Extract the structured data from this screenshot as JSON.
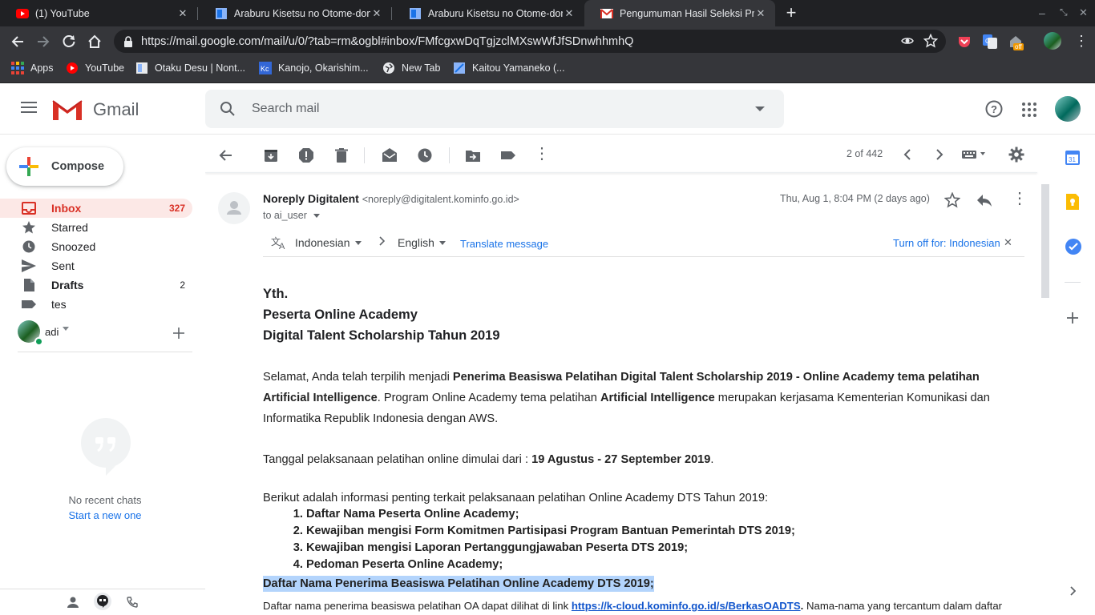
{
  "browser": {
    "tabs": [
      {
        "title": "(1) YouTube",
        "icon": "youtube-icon",
        "active": false
      },
      {
        "title": "Araburu Kisetsu no Otome-dom",
        "icon": "page-icon",
        "active": false
      },
      {
        "title": "Araburu Kisetsu no Otome-dom",
        "icon": "page-icon",
        "active": false
      },
      {
        "title": "Pengumuman Hasil Seleksi Pro",
        "icon": "gmail-icon",
        "active": true
      }
    ],
    "new_tab": "+",
    "url": "https://mail.google.com/mail/u/0/?tab=rm&ogbl#inbox/FMfcgxwDqTgjzclMXswWfJfSDnwhhmhQ",
    "ext_badge": "off",
    "bookmarks": [
      {
        "label": "Apps",
        "icon": "apps-grid-icon"
      },
      {
        "label": "YouTube",
        "icon": "youtube-icon"
      },
      {
        "label": "Otaku Desu | Nont...",
        "icon": "page-icon"
      },
      {
        "label": "Kanojo, Okarishim...",
        "icon": "kc-icon"
      },
      {
        "label": "New Tab",
        "icon": "globe-icon"
      },
      {
        "label": "Kaitou Yamaneko (...",
        "icon": "page-icon"
      }
    ]
  },
  "gmail": {
    "logo_text": "Gmail",
    "search_placeholder": "Search mail",
    "compose_label": "Compose",
    "nav": [
      {
        "label": "Inbox",
        "count": "327",
        "icon": "inbox-icon",
        "active": true
      },
      {
        "label": "Starred",
        "count": "",
        "icon": "star-icon",
        "active": false
      },
      {
        "label": "Snoozed",
        "count": "",
        "icon": "clock-icon",
        "active": false
      },
      {
        "label": "Sent",
        "count": "",
        "icon": "send-icon",
        "active": false
      },
      {
        "label": "Drafts",
        "count": "2",
        "icon": "draft-icon",
        "active": false
      },
      {
        "label": "tes",
        "count": "",
        "icon": "label-icon",
        "active": false
      }
    ],
    "hangouts": {
      "user": "adi",
      "no_chats": "No recent chats",
      "start_new": "Start a new one"
    },
    "toolbar": {
      "pager": "2 of 442"
    },
    "email": {
      "sender_name": "Noreply Digitalent",
      "sender_email": "<noreply@digitalent.kominfo.go.id>",
      "to": "to ai_user",
      "date": "Thu, Aug 1, 8:04 PM (2 days ago)",
      "translate": {
        "from_lang": "Indonesian",
        "to_lang": "English",
        "translate_link": "Translate message",
        "turn_off": "Turn off for: Indonesian"
      },
      "greeting": [
        "Yth.",
        "Peserta Online Academy",
        "Digital Talent Scholarship Tahun 2019"
      ],
      "p1_a": "Selamat, Anda telah terpilih menjadi ",
      "p1_b": "Penerima Beasiswa Pelatihan Digital Talent Scholarship 2019 - Online Academy tema pelatihan",
      "p1_c": "Artificial Intelligence",
      "p1_d": ". Program Online Academy tema pelatihan ",
      "p1_e": "Artificial Intelligence",
      "p1_f": " merupakan kerjasama Kementerian Komunikasi dan",
      "p1_g": "Informatika Republik Indonesia dengan AWS.",
      "p2_a": "Tanggal pelaksanaan pelatihan online dimulai dari : ",
      "p2_b": "19 Agustus - 27 September 2019",
      "p2_c": ".",
      "p3": "Berikut adalah informasi penting terkait pelaksanaan pelatihan Online Academy DTS Tahun 2019:",
      "list": [
        "Daftar Nama Peserta Online Academy;",
        "Kewajiban mengisi Form Komitmen Partisipasi Program Bantuan Pemerintah DTS 2019;",
        "Kewajiban mengisi Laporan Pertanggungjawaban Peserta DTS 2019;",
        "Pedoman Peserta Online Academy;"
      ],
      "highlight": "Daftar Nama Penerima Beasiswa Pelatihan Online Academy DTS 2019;",
      "last_a": "Daftar nama penerima beasiswa pelatihan OA dapat dilihat di link ",
      "last_link": "https://k-cloud.kominfo.go.id/s/BerkasOADTS",
      "last_b": ".",
      "last_c": " Nama-nama yang tercantum dalam daftar"
    }
  },
  "colors": {
    "accent_red": "#d93025",
    "link_blue": "#1a73e8",
    "highlight": "#b3d4fc"
  }
}
